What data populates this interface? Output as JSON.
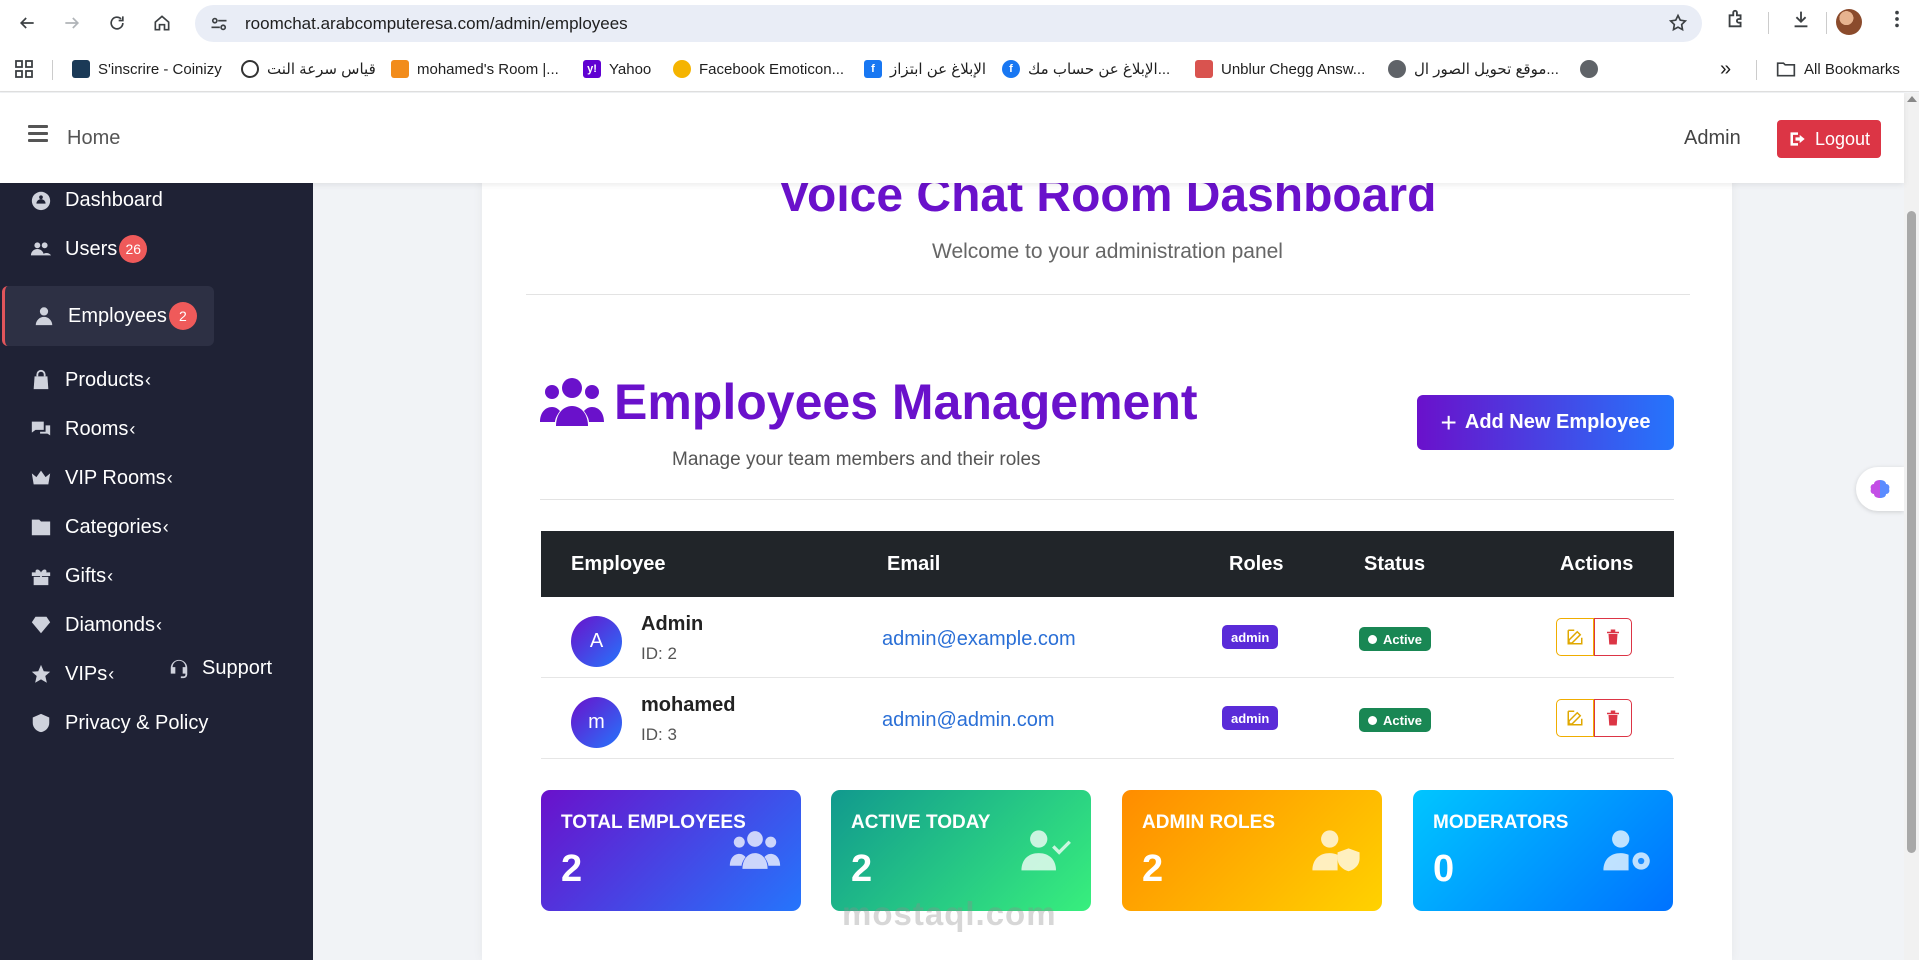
{
  "browser": {
    "url": "roomchat.arabcomputeresa.com/admin/employees",
    "bookmarks": [
      {
        "label": "S'inscrire - Coinizy",
        "color": "#1b3a57"
      },
      {
        "label": "قياس سرعة النت",
        "color": "#333333"
      },
      {
        "label": "mohamed's Room |...",
        "color": "#f28c1b"
      },
      {
        "label": "Yahoo",
        "color": "#6001d2"
      },
      {
        "label": "Facebook Emoticon...",
        "color": "#f5b400"
      },
      {
        "label": "الإبلاغ عن ابتزاز",
        "color": "#1877f2"
      },
      {
        "label": "الإبلاغ عن حساب مك...",
        "color": "#1877f2"
      },
      {
        "label": "Unblur Chegg Answ...",
        "color": "#d9534f"
      },
      {
        "label": "موقع تحويل الصور ال...",
        "color": "#5f6368"
      }
    ],
    "more_bookmarks": "»",
    "all_bookmarks": "All Bookmarks"
  },
  "header": {
    "home": "Home",
    "user": "Admin",
    "logout": "Logout"
  },
  "sidebar": {
    "items": [
      {
        "label": "Dashboard",
        "icon": "dashboard-icon"
      },
      {
        "label": "Users",
        "badge": "26",
        "icon": "users-icon"
      },
      {
        "label": "Employees",
        "badge": "2",
        "icon": "employee-icon",
        "active": true
      },
      {
        "label": "Products",
        "icon": "bag-icon"
      },
      {
        "label": "Rooms",
        "icon": "chat-icon"
      },
      {
        "label": "VIP Rooms",
        "icon": "crown-icon"
      },
      {
        "label": "Categories",
        "icon": "folder-icon"
      },
      {
        "label": "Gifts",
        "icon": "gift-icon"
      },
      {
        "label": "Diamonds",
        "icon": "diamond-icon"
      },
      {
        "label": "VIPs",
        "icon": "star-icon"
      },
      {
        "label": "Privacy & Policy",
        "icon": "shield-icon"
      }
    ],
    "chevron": "‹",
    "support": "Support"
  },
  "dashboard": {
    "title": "Voice Chat Room Dashboard",
    "welcome": "Welcome to your administration panel"
  },
  "employees": {
    "title": "Employees Management",
    "subtitle": "Manage your team members and their roles",
    "add_button": "Add New Employee",
    "columns": [
      "Employee",
      "Email",
      "Roles",
      "Status",
      "Actions"
    ],
    "rows": [
      {
        "initial": "A",
        "name": "Admin",
        "id": "ID: 2",
        "email": "admin@example.com",
        "role": "admin",
        "status": "Active"
      },
      {
        "initial": "m",
        "name": "mohamed",
        "id": "ID: 3",
        "email": "admin@admin.com",
        "role": "admin",
        "status": "Active"
      }
    ]
  },
  "stats": [
    {
      "label": "TOTAL EMPLOYEES",
      "value": "2",
      "gradient": [
        "#6a11cb",
        "#2575fc"
      ]
    },
    {
      "label": "ACTIVE TODAY",
      "value": "2",
      "gradient": [
        "#11998e",
        "#38ef7d"
      ]
    },
    {
      "label": "ADMIN ROLES",
      "value": "2",
      "gradient": [
        "#ff8c00",
        "#ffd200"
      ]
    },
    {
      "label": "MODERATORS",
      "value": "0",
      "gradient": [
        "#00c6ff",
        "#0072ff"
      ]
    }
  ],
  "watermark": "mostaql.com",
  "colors": {
    "accent": "#6a11cb",
    "danger": "#dc3545",
    "success": "#198754",
    "sidebar": "#1f2235"
  }
}
